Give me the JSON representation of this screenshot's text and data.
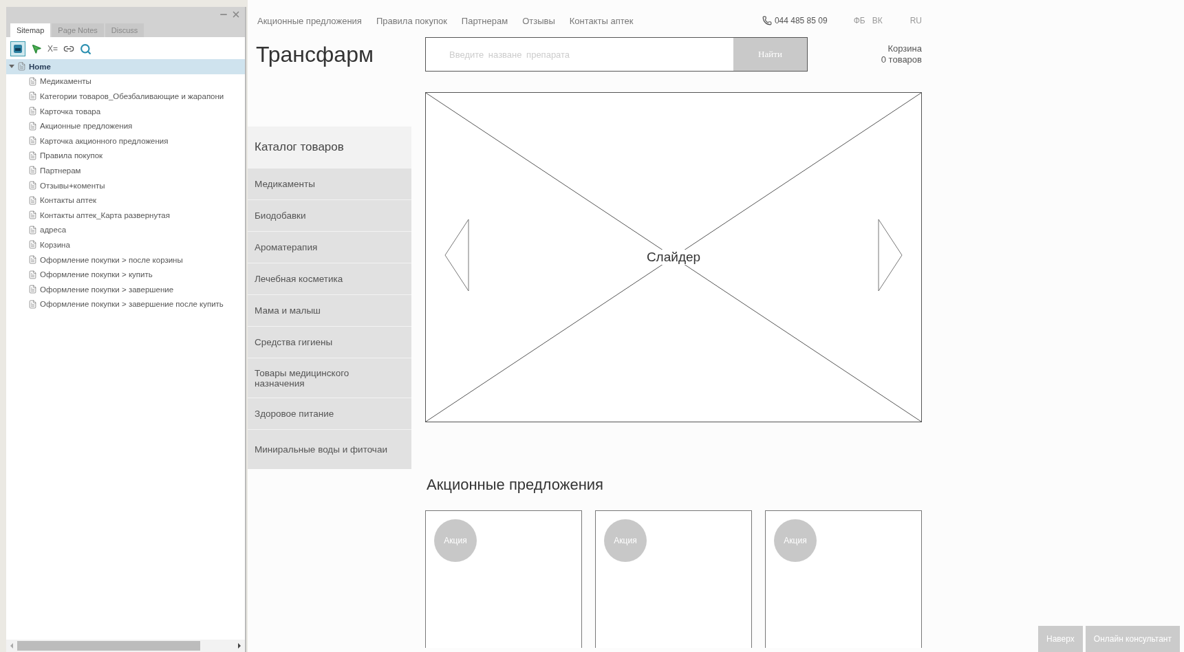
{
  "sitemap_panel": {
    "tabs": [
      {
        "label": "Sitemap",
        "selected": true
      },
      {
        "label": "Page Notes",
        "selected": false
      },
      {
        "label": "Discuss",
        "selected": false
      }
    ],
    "toolbar": {
      "variables_label": "X="
    },
    "tree": [
      {
        "label": "Home",
        "expanded": true,
        "selected": true,
        "children": [
          {
            "label": "Медикаменты",
            "selected": false
          },
          {
            "label": "Категории товаров_Обезбаливающие и жарапони",
            "selected": false
          },
          {
            "label": "Карточка товара",
            "selected": false
          },
          {
            "label": "Акционные предложения",
            "selected": false
          },
          {
            "label": "Карточка акционного предложения",
            "selected": false
          },
          {
            "label": "Правила покупок",
            "selected": false
          },
          {
            "label": "Партнерам",
            "selected": false
          },
          {
            "label": "Отзывы+коменты",
            "selected": false
          },
          {
            "label": "Контакты аптек",
            "selected": false
          },
          {
            "label": "Контакты аптек_Карта развернутая",
            "selected": false
          },
          {
            "label": "адреса",
            "selected": false
          },
          {
            "label": "Корзина",
            "selected": false
          },
          {
            "label": "Оформление покупки > после корзины",
            "selected": false
          },
          {
            "label": "Оформление покупки > купить",
            "selected": false
          },
          {
            "label": "Оформление покупки > завершение",
            "selected": false
          },
          {
            "label": "Оформление покупки > завершение после купить",
            "selected": false
          }
        ]
      }
    ]
  },
  "site": {
    "nav": [
      "Акционные предложения",
      "Правила покупок",
      "Партнерам",
      "Отзывы",
      "Контакты аптек"
    ],
    "phone": "044 485 85 09",
    "social": [
      "ФБ",
      "ВК"
    ],
    "language": "RU",
    "logo": "Трансфарм",
    "search": {
      "placeholder": "Введите назване препарата",
      "button": "Найти"
    },
    "cart": {
      "title": "Корзина",
      "count": "0 товаров"
    },
    "catalog": {
      "title": "Каталог товаров",
      "items": [
        "Медикаменты",
        "Биодобавки",
        "Ароматерапия",
        "Лечебная косметика",
        "Мама и малыш",
        "Средства гигиены",
        "Товары медицинского назначения",
        "Здоровое питание",
        "Миниральные воды и фиточаи"
      ]
    },
    "slider": {
      "label": "Слайдер"
    },
    "promotions": {
      "title": "Акционные предложения",
      "cards": [
        {
          "badge": "Акция"
        },
        {
          "badge": "Акция"
        },
        {
          "badge": "Акция"
        }
      ]
    },
    "floating_buttons": [
      "Наверх",
      "Онлайн консультант"
    ]
  }
}
